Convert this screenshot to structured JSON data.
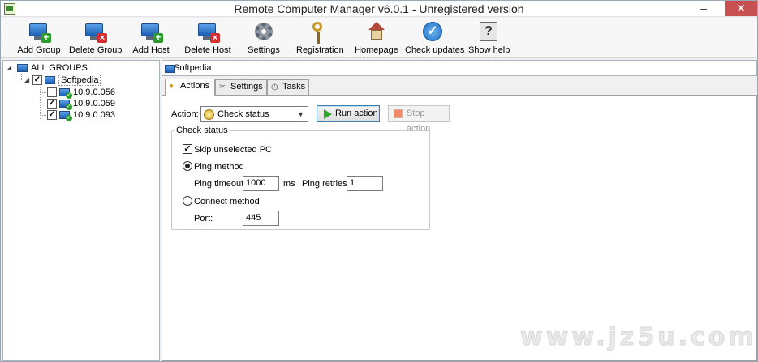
{
  "window": {
    "title": "Remote Computer Manager v6.0.1 - Unregistered version",
    "minimize": "–",
    "close": "✕"
  },
  "toolbar": {
    "items": [
      {
        "label": "Add Group",
        "icon": "add-group-icon"
      },
      {
        "label": "Delete Group",
        "icon": "delete-group-icon"
      },
      {
        "label": "Add Host",
        "icon": "add-host-icon"
      },
      {
        "label": "Delete Host",
        "icon": "delete-host-icon"
      },
      {
        "label": "Settings",
        "icon": "gear-icon"
      },
      {
        "label": "Registration",
        "icon": "key-icon"
      },
      {
        "label": "Homepage",
        "icon": "home-icon"
      },
      {
        "label": "Check updates",
        "icon": "check-circle-icon"
      },
      {
        "label": "Show help",
        "icon": "help-icon"
      }
    ]
  },
  "tree": {
    "root": "ALL GROUPS",
    "group": {
      "label": "Softpedia",
      "checked": true
    },
    "hosts": [
      {
        "label": "10.9.0.056",
        "checked": false
      },
      {
        "label": "10.9.0.059",
        "checked": true
      },
      {
        "label": "10.9.0.093",
        "checked": true
      }
    ]
  },
  "main": {
    "header": "Softpedia",
    "tabs": [
      {
        "label": "Actions",
        "active": true
      },
      {
        "label": "Settings",
        "active": false
      },
      {
        "label": "Tasks",
        "active": false
      }
    ],
    "action_label": "Action:",
    "action_value": "Check status",
    "run_action": "Run action",
    "stop_action": "Stop action",
    "group_title": "Check status",
    "skip_unselected": "Skip unselected PC",
    "ping_method": "Ping method",
    "ping_timeout_label": "Ping timeout:",
    "ping_timeout_value": "1000",
    "ms_label": "ms",
    "ping_retries_label": "Ping retries:",
    "ping_retries_value": "1",
    "connect_method": "Connect method",
    "port_label": "Port:",
    "port_value": "445"
  },
  "watermark": "www.jz5u.com"
}
